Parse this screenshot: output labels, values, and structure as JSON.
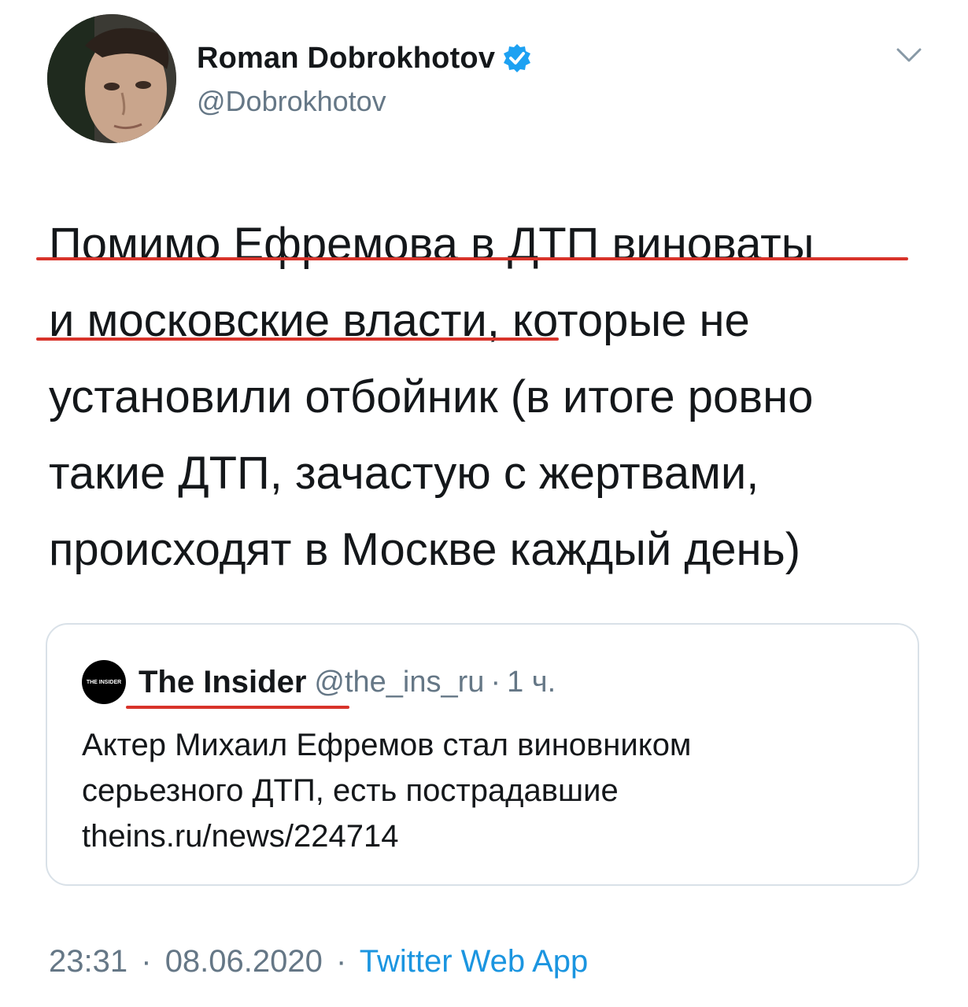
{
  "author": {
    "display_name": "Roman Dobrokhotov",
    "handle": "@Dobrokhotov",
    "verified_icon": "verified-badge-icon",
    "avatar": "profile-photo"
  },
  "menu": {
    "icon": "chevron-down-icon"
  },
  "tweet": {
    "lines": [
      "Помимо Ефремова в ДТП виноваты",
      "и московские власти, которые не",
      "установили отбойник (в итоге ровно",
      "такие ДТП, зачастую с жертвами,",
      "происходят в Москве каждый день)"
    ]
  },
  "quote": {
    "avatar_text": "THE INSIDER",
    "name": "The Insider",
    "handle": "@the_ins_ru",
    "separator": "·",
    "time": "1 ч.",
    "lines": [
      "Актер Михаил Ефремов стал виновником",
      "серьезного ДТП, есть пострадавшие",
      "theins.ru/news/224714"
    ]
  },
  "footer": {
    "time": "23:31",
    "date": "08.06.2020",
    "separator": "·",
    "source": "Twitter Web App"
  },
  "colors": {
    "text": "#14171a",
    "secondary": "#657786",
    "link": "#1b95e0",
    "verified": "#1da1f2",
    "annotation": "#d8332a",
    "card_border": "#d9e1e8"
  }
}
